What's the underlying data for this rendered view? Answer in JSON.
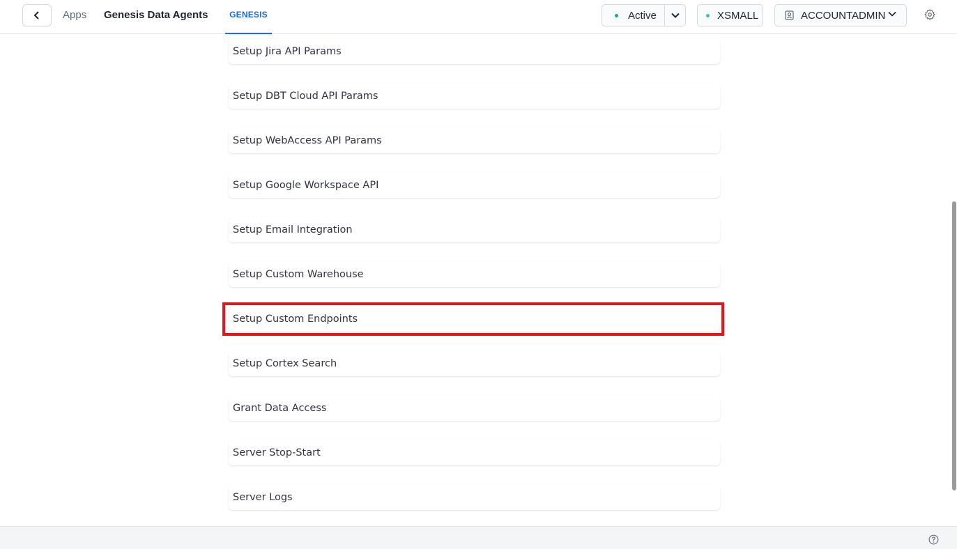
{
  "header": {
    "apps_label": "Apps",
    "app_title": "Genesis Data Agents",
    "tab_label": "GENESIS",
    "status_label": "Active",
    "warehouse_label": "XSMALL",
    "role_label": "ACCOUNTADMIN"
  },
  "menu": {
    "items": [
      "Setup Jira API Params",
      "Setup DBT Cloud API Params",
      "Setup WebAccess API Params",
      "Setup Google Workspace API",
      "Setup Email Integration",
      "Setup Custom Warehouse",
      "Setup Custom Endpoints",
      "Setup Cortex Search",
      "Grant Data Access",
      "Server Stop-Start",
      "Server Logs"
    ],
    "highlighted_index": 6
  },
  "colors": {
    "accent": "#1a6ce7",
    "status_dot": "#1fae6b",
    "highlight": "#e3161c"
  },
  "icons": [
    "chevron-left-icon",
    "chevron-down-icon",
    "user-badge-icon",
    "gear-icon",
    "help-icon"
  ]
}
